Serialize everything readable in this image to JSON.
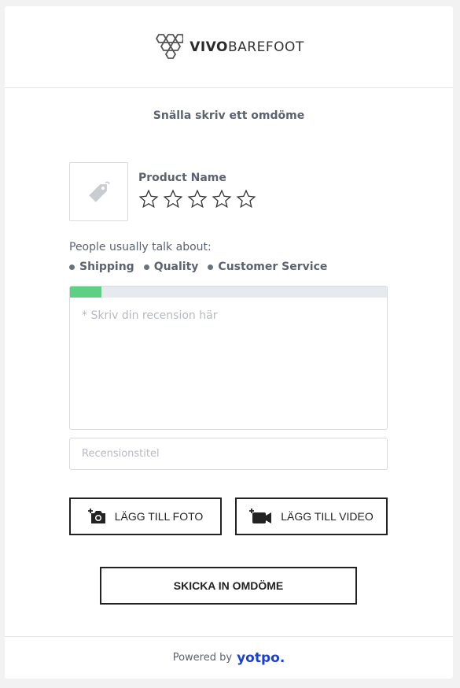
{
  "brand": {
    "bold": "VIVO",
    "light": "BAREFOOT"
  },
  "form_title": "Snälla skriv ett omdöme",
  "product": {
    "name": "Product Name",
    "rating": 0,
    "max_rating": 5
  },
  "talk_about": {
    "label": "People usually talk about:",
    "topics": [
      "Shipping",
      "Quality",
      "Customer Service"
    ]
  },
  "review": {
    "placeholder": "* Skriv din recension här",
    "progress_percent": 10,
    "progress_color": "#5cd184"
  },
  "review_title": {
    "placeholder": "Recensionstitel"
  },
  "buttons": {
    "add_photo": "LÄGG TILL FOTO",
    "add_video": "LÄGG TILL VIDEO",
    "submit": "SKICKA IN OMDÖME"
  },
  "footer": {
    "powered_by": "Powered by",
    "provider": "yotpo."
  }
}
